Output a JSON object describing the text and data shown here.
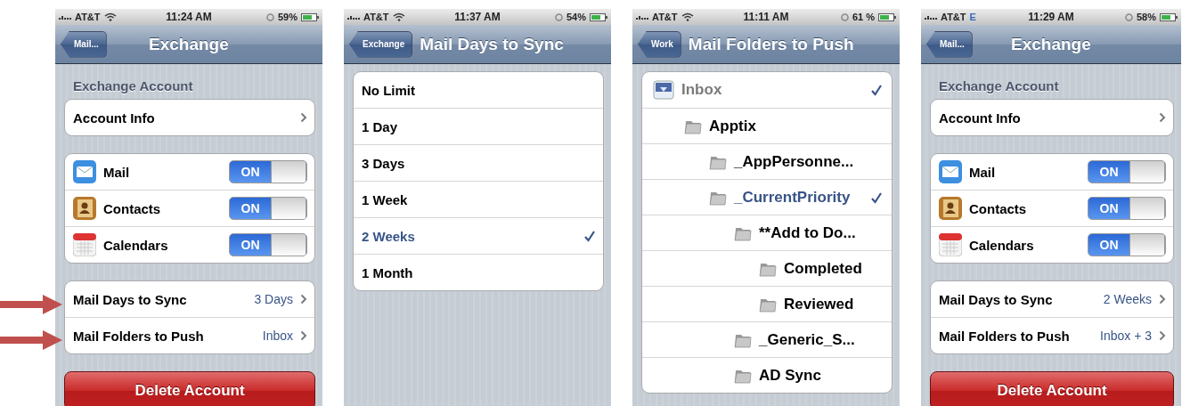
{
  "screens": [
    {
      "kind": "settings",
      "status": {
        "carrier": "AT&T",
        "wifi": true,
        "time": "11:24 AM",
        "battery": "59%"
      },
      "nav": {
        "back": "Mail...",
        "title": "Exchange"
      },
      "section_header": "Exchange Account",
      "groups": [
        {
          "rows": [
            {
              "kind": "link",
              "label": "Account Info"
            }
          ]
        },
        {
          "rows": [
            {
              "kind": "toggle",
              "label": "Mail",
              "toggle": "ON",
              "on": true
            },
            {
              "kind": "toggle",
              "label": "Contacts",
              "toggle": "ON",
              "on": true
            },
            {
              "kind": "toggle",
              "label": "Calendars",
              "toggle": "ON",
              "on": true
            }
          ]
        },
        {
          "rows": [
            {
              "kind": "value",
              "label": "Mail Days to Sync",
              "value": "3 Days"
            },
            {
              "kind": "value",
              "label": "Mail Folders to Push",
              "value": "Inbox"
            }
          ]
        }
      ],
      "button": "Delete Account"
    },
    {
      "kind": "options",
      "status": {
        "carrier": "AT&T",
        "wifi": true,
        "time": "11:37 AM",
        "battery": "54%"
      },
      "nav": {
        "back": "Exchange",
        "title": "Mail Days to Sync"
      },
      "options": [
        {
          "label": "No Limit",
          "selected": false
        },
        {
          "label": "1 Day",
          "selected": false
        },
        {
          "label": "3 Days",
          "selected": false
        },
        {
          "label": "1 Week",
          "selected": false
        },
        {
          "label": "2 Weeks",
          "selected": true
        },
        {
          "label": "1 Month",
          "selected": false
        }
      ]
    },
    {
      "kind": "folders",
      "status": {
        "carrier": "AT&T",
        "wifi": true,
        "time": "11:11 AM",
        "battery": "61 %"
      },
      "nav": {
        "back": "Work",
        "title": "Mail Folders to Push"
      },
      "folders": [
        {
          "label": "Inbox",
          "kind": "inbox",
          "selected": true,
          "children": [
            {
              "label": "Apptix",
              "kind": "folder",
              "selected": false,
              "children": [
                {
                  "label": "_AppPersonne...",
                  "kind": "folder",
                  "selected": false
                },
                {
                  "label": "_CurrentPriority",
                  "kind": "folder",
                  "selected": true,
                  "children": [
                    {
                      "label": "**Add to Do...",
                      "kind": "folder",
                      "selected": false,
                      "children": [
                        {
                          "label": "Completed",
                          "kind": "folder",
                          "selected": false
                        },
                        {
                          "label": "Reviewed",
                          "kind": "folder",
                          "selected": false
                        }
                      ]
                    },
                    {
                      "label": "_Generic_S...",
                      "kind": "folder",
                      "selected": false
                    },
                    {
                      "label": "AD Sync",
                      "kind": "folder",
                      "selected": false
                    }
                  ]
                }
              ]
            }
          ]
        }
      ]
    },
    {
      "kind": "settings",
      "status": {
        "carrier": "AT&T",
        "wifi": false,
        "network": "E",
        "time": "11:29 AM",
        "battery": "58%"
      },
      "nav": {
        "back": "Mail...",
        "title": "Exchange"
      },
      "section_header": "Exchange Account",
      "groups": [
        {
          "rows": [
            {
              "kind": "link",
              "label": "Account Info"
            }
          ]
        },
        {
          "rows": [
            {
              "kind": "toggle",
              "label": "Mail",
              "toggle": "ON",
              "on": true
            },
            {
              "kind": "toggle",
              "label": "Contacts",
              "toggle": "ON",
              "on": true
            },
            {
              "kind": "toggle",
              "label": "Calendars",
              "toggle": "ON",
              "on": true
            }
          ]
        },
        {
          "rows": [
            {
              "kind": "value",
              "label": "Mail Days to Sync",
              "value": "2 Weeks"
            },
            {
              "kind": "value",
              "label": "Mail Folders to Push",
              "value": "Inbox + 3"
            }
          ]
        }
      ],
      "button": "Delete Account"
    }
  ]
}
